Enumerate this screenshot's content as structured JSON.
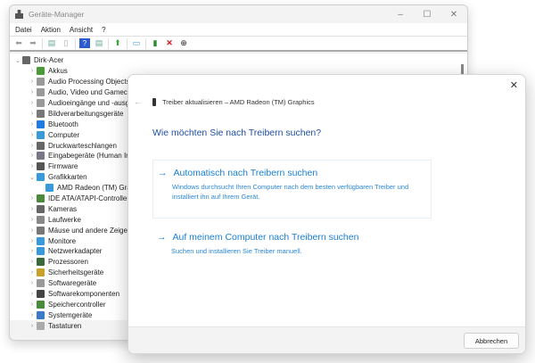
{
  "device_manager": {
    "title": "Geräte-Manager",
    "menu": [
      "Datei",
      "Aktion",
      "Ansicht",
      "?"
    ],
    "root": "Dirk-Acer",
    "items": [
      {
        "label": "Akkus",
        "color": "#4a9a3a",
        "expanded": false
      },
      {
        "label": "Audio Processing Objects (",
        "color": "#999",
        "expanded": false
      },
      {
        "label": "Audio, Video und Gameco",
        "color": "#999",
        "expanded": false
      },
      {
        "label": "Audioeingänge und -ausg",
        "color": "#999",
        "expanded": false
      },
      {
        "label": "Bildverarbeitungsgeräte",
        "color": "#777",
        "expanded": false
      },
      {
        "label": "Bluetooth",
        "color": "#1e7ce0",
        "expanded": false
      },
      {
        "label": "Computer",
        "color": "#3a9ad9",
        "expanded": false
      },
      {
        "label": "Druckwarteschlangen",
        "color": "#666",
        "expanded": false
      },
      {
        "label": "Eingabegeräte (Human Int",
        "color": "#778",
        "expanded": false
      },
      {
        "label": "Firmware",
        "color": "#555",
        "expanded": false
      },
      {
        "label": "Grafikkarten",
        "color": "#3a9ad9",
        "expanded": true
      },
      {
        "label": "AMD Radeon (TM) Gra",
        "color": "#3a9ad9",
        "child": true
      },
      {
        "label": "IDE ATA/ATAPI-Controller",
        "color": "#4a8a3a",
        "expanded": false
      },
      {
        "label": "Kameras",
        "color": "#666",
        "expanded": false
      },
      {
        "label": "Laufwerke",
        "color": "#888",
        "expanded": false
      },
      {
        "label": "Mäuse und andere Zeigeg",
        "color": "#777",
        "expanded": false
      },
      {
        "label": "Monitore",
        "color": "#3a9ad9",
        "expanded": false
      },
      {
        "label": "Netzwerkadapter",
        "color": "#3a9ad9",
        "expanded": false
      },
      {
        "label": "Prozessoren",
        "color": "#3a6a3a",
        "expanded": false
      },
      {
        "label": "Sicherheitsgeräte",
        "color": "#c9a02a",
        "expanded": false
      },
      {
        "label": "Softwaregeräte",
        "color": "#999",
        "expanded": false
      },
      {
        "label": "Softwarekomponenten",
        "color": "#444",
        "expanded": false
      },
      {
        "label": "Speichercontroller",
        "color": "#4a8a3a",
        "expanded": false
      },
      {
        "label": "Systemgeräte",
        "color": "#3a7ac9",
        "expanded": false
      },
      {
        "label": "Tastaturen",
        "color": "#aaa",
        "expanded": false
      }
    ]
  },
  "dialog": {
    "header": "Treiber aktualisieren – AMD Radeon (TM) Graphics",
    "question": "Wie möchten Sie nach Treibern suchen?",
    "option1_title": "Automatisch nach Treibern suchen",
    "option1_desc": "Windows durchsucht Ihren Computer nach dem besten verfügbaren Treiber und installiert ihn auf Ihrem Gerät.",
    "option2_title": "Auf meinem Computer nach Treibern suchen",
    "option2_desc": "Suchen und installieren Sie Treiber manuell.",
    "cancel": "Abbrechen"
  }
}
